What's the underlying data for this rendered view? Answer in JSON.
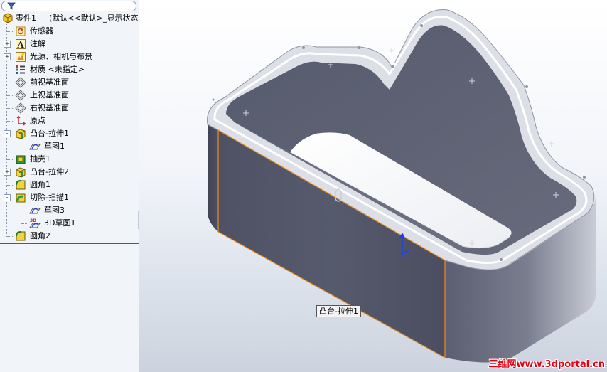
{
  "feature_tree": {
    "root": {
      "label": "零件1",
      "config": "(默认<<默认>_显示状态"
    },
    "items": [
      {
        "label": "传感器",
        "icon": "sensor-icon",
        "expander": ""
      },
      {
        "label": "注解",
        "icon": "annotation-icon",
        "expander": "+"
      },
      {
        "label": "光源、相机与布景",
        "icon": "lights-cameras-icon",
        "expander": "+"
      },
      {
        "label": "材质 <未指定>",
        "icon": "material-icon",
        "expander": ""
      },
      {
        "label": "前视基准面",
        "icon": "plane-icon",
        "expander": ""
      },
      {
        "label": "上视基准面",
        "icon": "plane-icon",
        "expander": ""
      },
      {
        "label": "右视基准面",
        "icon": "plane-icon",
        "expander": ""
      },
      {
        "label": "原点",
        "icon": "origin-icon",
        "expander": ""
      },
      {
        "label": "凸台-拉伸1",
        "icon": "boss-extrude-icon",
        "expander": "-"
      },
      {
        "label": "草图1",
        "icon": "sketch-icon",
        "expander": ""
      },
      {
        "label": "抽壳1",
        "icon": "shell-icon",
        "expander": ""
      },
      {
        "label": "凸台-拉伸2",
        "icon": "boss-extrude-icon",
        "expander": "+"
      },
      {
        "label": "圆角1",
        "icon": "fillet-icon",
        "expander": ""
      },
      {
        "label": "切除-扫描1",
        "icon": "cut-sweep-icon",
        "expander": "-"
      },
      {
        "label": "草图3",
        "icon": "sketch-icon",
        "expander": ""
      },
      {
        "label": "3D草图1",
        "icon": "3d-sketch-icon",
        "expander": ""
      },
      {
        "label": "圆角2",
        "icon": "fillet-icon",
        "expander": ""
      }
    ]
  },
  "viewport": {
    "tooltip": "凸台-拉伸1",
    "watermark": "三维网www.3dportal.cn"
  },
  "colors": {
    "panel_bg": "#f1f4f9",
    "rollback_bar": "#2e5db8",
    "model_dark": "#5a5e70",
    "highlight_edge": "#f08a1c",
    "origin_blue": "#1a3cff",
    "watermark_red": "#e60012"
  }
}
